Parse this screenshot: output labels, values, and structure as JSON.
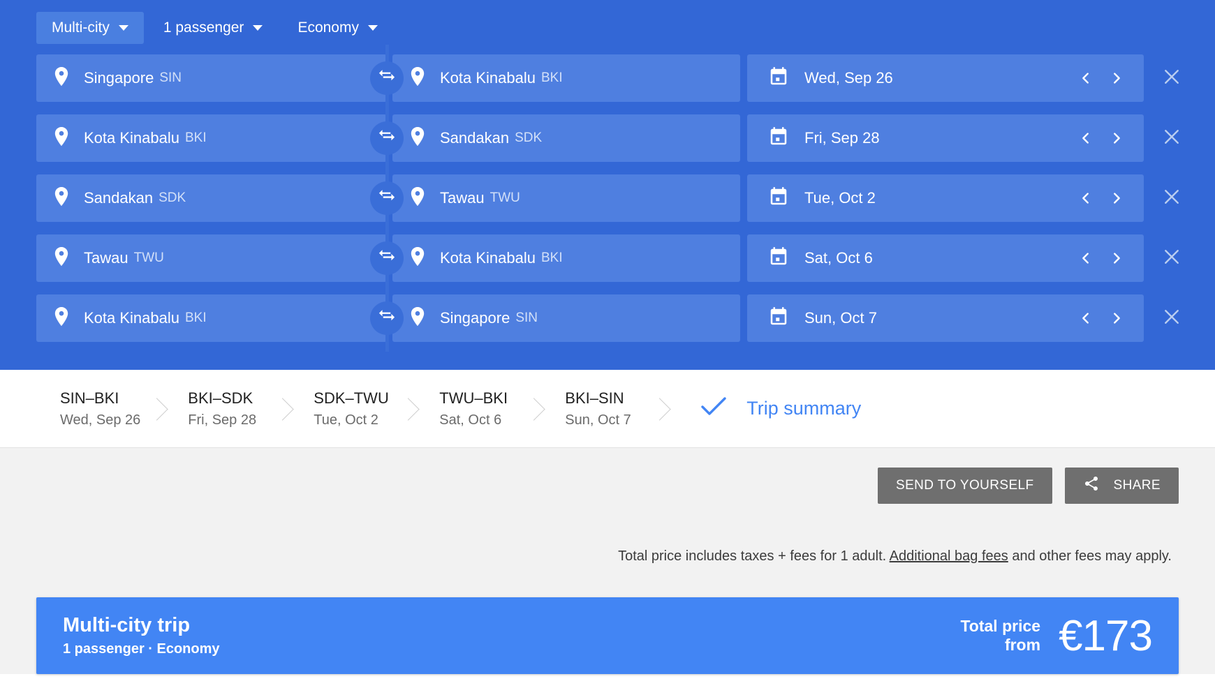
{
  "options": {
    "trip_type": "Multi-city",
    "passengers": "1 passenger",
    "cabin": "Economy"
  },
  "flights": [
    {
      "origin": "Singapore",
      "origin_code": "SIN",
      "destination": "Kota Kinabalu",
      "destination_code": "BKI",
      "date": "Wed, Sep 26"
    },
    {
      "origin": "Kota Kinabalu",
      "origin_code": "BKI",
      "destination": "Sandakan",
      "destination_code": "SDK",
      "date": "Fri, Sep 28"
    },
    {
      "origin": "Sandakan",
      "origin_code": "SDK",
      "destination": "Tawau",
      "destination_code": "TWU",
      "date": "Tue, Oct 2"
    },
    {
      "origin": "Tawau",
      "origin_code": "TWU",
      "destination": "Kota Kinabalu",
      "destination_code": "BKI",
      "date": "Sat, Oct 6"
    },
    {
      "origin": "Kota Kinabalu",
      "origin_code": "BKI",
      "destination": "Singapore",
      "destination_code": "SIN",
      "date": "Sun, Oct 7"
    }
  ],
  "tabs": [
    {
      "code": "SIN–BKI",
      "date": "Wed, Sep 26"
    },
    {
      "code": "BKI–SDK",
      "date": "Fri, Sep 28"
    },
    {
      "code": "SDK–TWU",
      "date": "Tue, Oct 2"
    },
    {
      "code": "TWU–BKI",
      "date": "Sat, Oct 6"
    },
    {
      "code": "BKI–SIN",
      "date": "Sun, Oct 7"
    }
  ],
  "summary_tab": {
    "label": "Trip summary"
  },
  "actions": {
    "send_to_yourself": "SEND TO YOURSELF",
    "share": "SHARE"
  },
  "disclaimer": {
    "before_link": "Total price includes taxes + fees for 1 adult. ",
    "link": "Additional bag fees",
    "after_link": " and other fees may apply."
  },
  "price_banner": {
    "title": "Multi-city trip",
    "subtitle": "1 passenger · Economy",
    "total_label_line1": "Total price",
    "total_label_line2": "from",
    "amount": "€173"
  },
  "colors": {
    "panel_blue": "#3367d6",
    "field_blue": "#4f7fe0",
    "accent_blue": "#4285f4",
    "button_gray": "#6f6f6f"
  }
}
